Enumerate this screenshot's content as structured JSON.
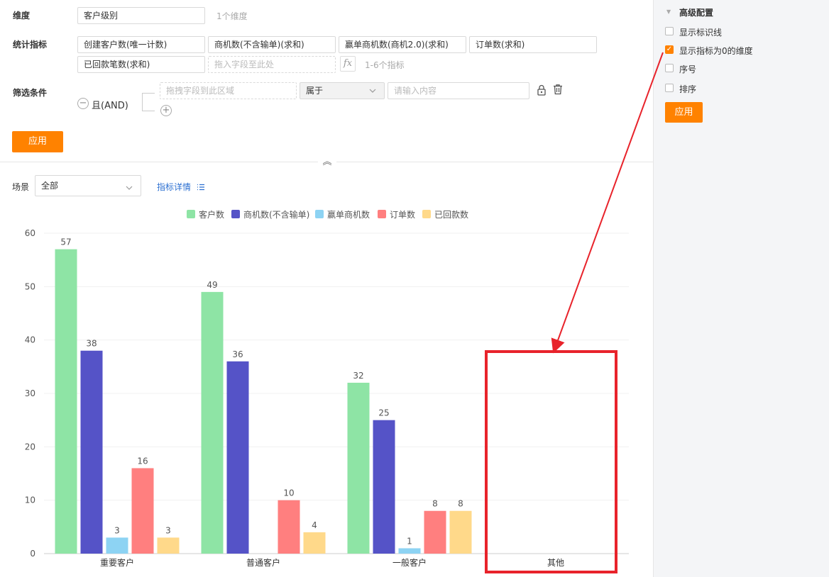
{
  "config": {
    "dimension_label": "维度",
    "dimension_value": "客户级别",
    "dimension_count": "1个维度",
    "metrics_label": "统计指标",
    "metrics": [
      "创建客户数(唯一计数)",
      "商机数(不含输单)(求和)",
      "赢单商机数(商机2.0)(求和)",
      "订单数(求和)",
      "已回款笔数(求和)"
    ],
    "metrics_drop_placeholder": "拖入字段至此处",
    "metrics_count_hint": "1-6个指标",
    "fx_label": "fx",
    "filter_label": "筛选条件",
    "filter_logic": "且(AND)",
    "filter_field_placeholder": "拖拽字段到此区域",
    "filter_operator": "属于",
    "filter_value_placeholder": "请输入内容",
    "apply_label": "应用",
    "minus_symbol": "−",
    "plus_symbol": "+",
    "collapse_symbol": "︽"
  },
  "scene": {
    "label": "场景",
    "value": "全部",
    "detail_link": "指标详情",
    "detail_icon": "list-icon"
  },
  "advanced": {
    "title": "高级配置",
    "options": [
      {
        "label": "显示标识线",
        "checked": false
      },
      {
        "label": "显示指标为0的维度",
        "checked": true
      },
      {
        "label": "序号",
        "checked": false
      },
      {
        "label": "排序",
        "checked": false
      }
    ],
    "apply_label": "应用"
  },
  "colors": {
    "accent": "#ff8200",
    "highlight": "#e8232b",
    "series": [
      "#8ee4a5",
      "#5553c7",
      "#8dd3f3",
      "#ff7f7f",
      "#ffd98a"
    ]
  },
  "chart_data": {
    "type": "bar",
    "categories": [
      "重要客户",
      "普通客户",
      "一般客户",
      "其他"
    ],
    "series": [
      {
        "name": "客户数",
        "values": [
          57,
          49,
          32,
          0
        ]
      },
      {
        "name": "商机数(不含输单)",
        "values": [
          38,
          36,
          25,
          0
        ]
      },
      {
        "name": "赢单商机数",
        "values": [
          3,
          0,
          1,
          0
        ]
      },
      {
        "name": "订单数",
        "values": [
          16,
          10,
          8,
          0
        ]
      },
      {
        "name": "已回款数",
        "values": [
          3,
          4,
          8,
          0
        ]
      }
    ],
    "yticks": [
      0,
      10,
      20,
      30,
      40,
      50,
      60
    ],
    "ylim": [
      0,
      60
    ],
    "grid": true,
    "legend": "top-center",
    "title": "",
    "xlabel": "",
    "ylabel": ""
  }
}
